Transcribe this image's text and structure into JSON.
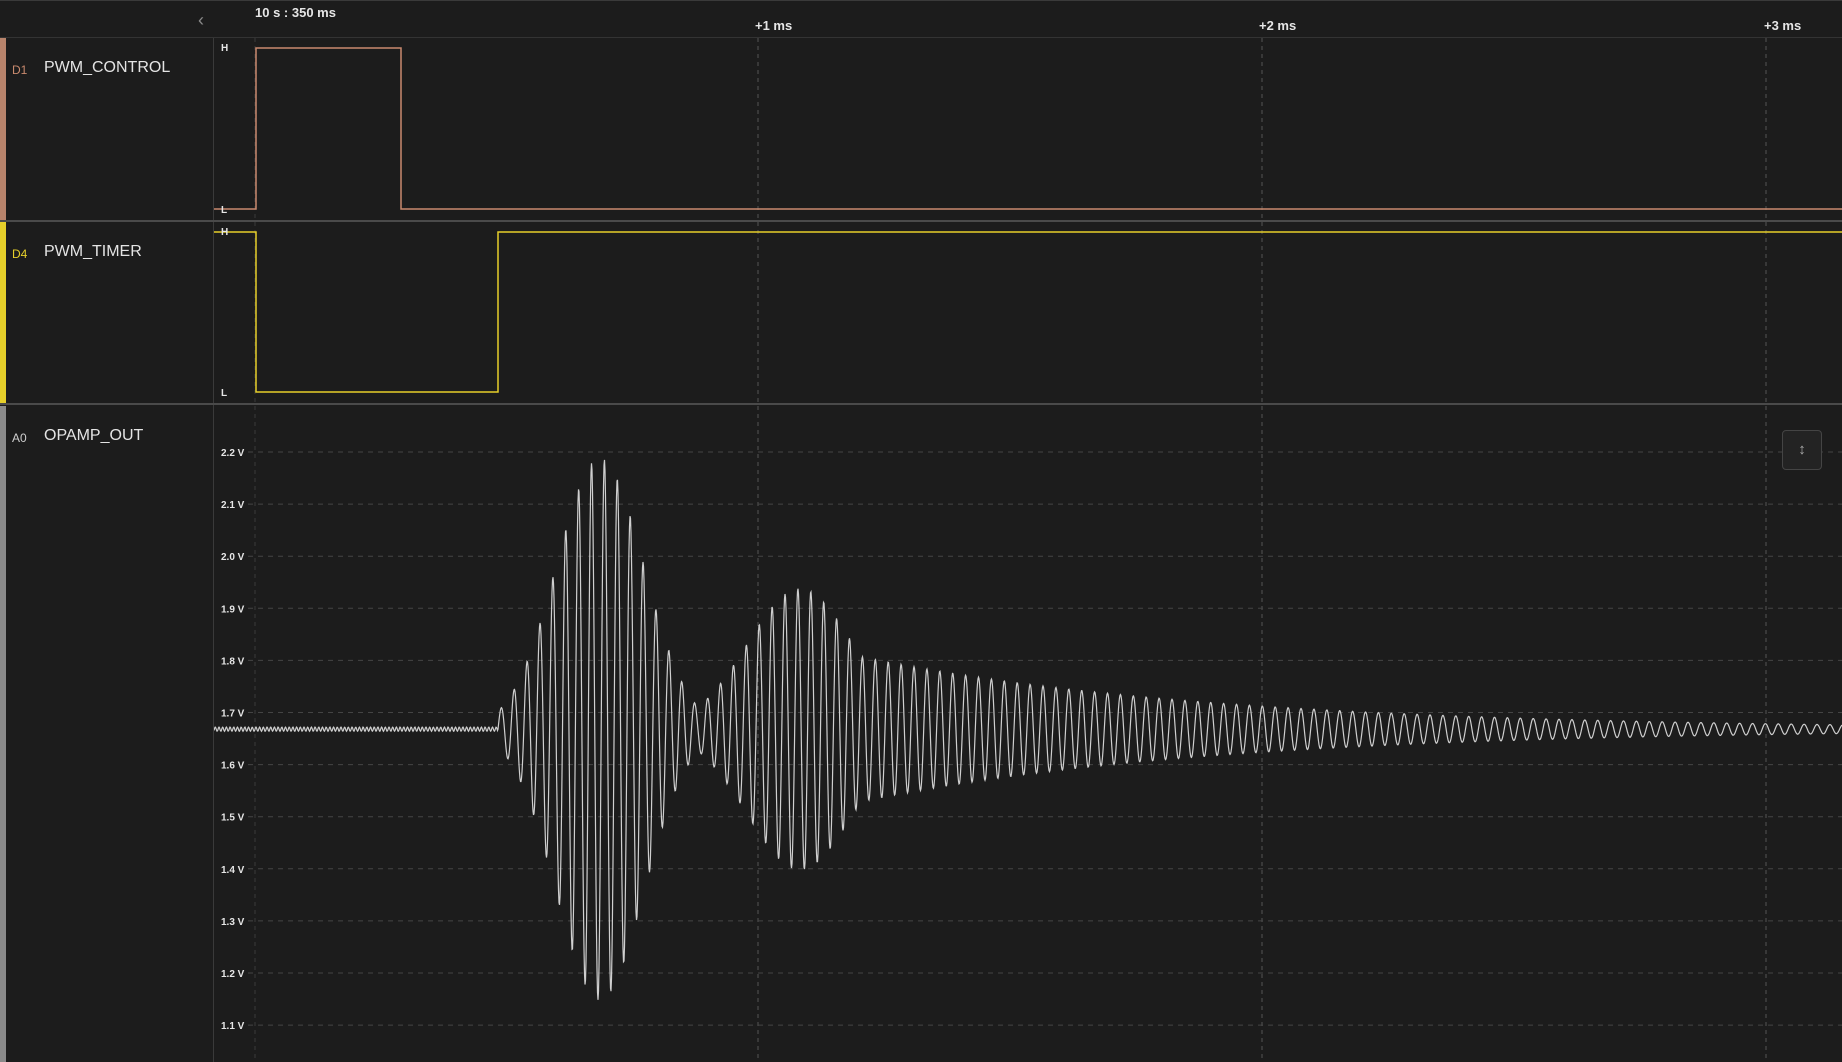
{
  "timeline": {
    "start_label": "10 s : 350 ms",
    "ticks": [
      {
        "label": "+1 ms",
        "ms": 1
      },
      {
        "label": "+2 ms",
        "ms": 2
      },
      {
        "label": "+3 ms",
        "ms": 3
      }
    ]
  },
  "channels": [
    {
      "id": "D1",
      "name": "PWM_CONTROL",
      "color": "#c98a6e",
      "high_label": "H",
      "low_label": "L"
    },
    {
      "id": "D4",
      "name": "PWM_TIMER",
      "color": "#e6cf2a",
      "high_label": "H",
      "low_label": "L"
    },
    {
      "id": "A0",
      "name": "OPAMP_OUT",
      "color": "#cfcfcf",
      "voltage_labels": [
        "2.2 V",
        "2.1 V",
        "2.0 V",
        "1.9 V",
        "1.8 V",
        "1.7 V",
        "1.6 V",
        "1.5 V",
        "1.4 V",
        "1.3 V",
        "1.2 V",
        "1.1 V"
      ]
    }
  ],
  "icons": {
    "collapse": "chevron-left-icon",
    "fit": "fit-height-icon"
  }
}
